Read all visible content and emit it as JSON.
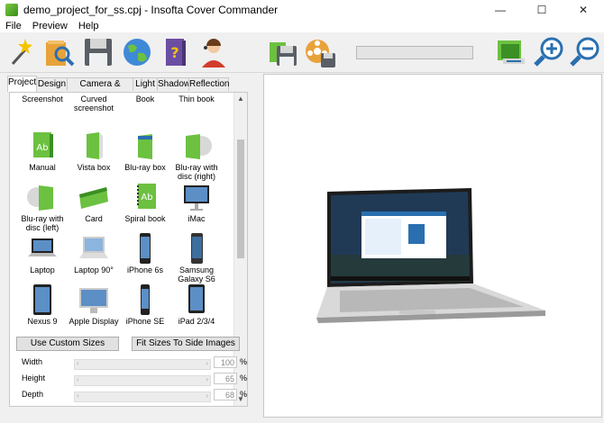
{
  "window": {
    "title": "demo_project_for_ss.cpj - Insofta Cover Commander",
    "minimize": "—",
    "maximize": "☐",
    "close": "✕"
  },
  "menu": [
    "File",
    "Preview",
    "Help"
  ],
  "tabs": [
    "Project",
    "Design",
    "Camera & Position",
    "Light",
    "Shadow",
    "Reflection"
  ],
  "gallery": {
    "items": [
      {
        "label": "Screenshot",
        "icon": "screenshot-icon"
      },
      {
        "label": "Curved screenshot",
        "icon": "curved-screenshot-icon"
      },
      {
        "label": "Book",
        "icon": "book-icon"
      },
      {
        "label": "Thin book",
        "icon": "thin-book-icon"
      },
      {
        "label": "Manual",
        "icon": "manual-icon"
      },
      {
        "label": "Vista box",
        "icon": "vista-box-icon"
      },
      {
        "label": "Blu-ray box",
        "icon": "blu-ray-box-icon"
      },
      {
        "label": "Blu-ray with disc (right)",
        "icon": "blu-ray-disc-right-icon"
      },
      {
        "label": "Blu-ray with disc (left)",
        "icon": "blu-ray-disc-left-icon"
      },
      {
        "label": "Card",
        "icon": "card-icon"
      },
      {
        "label": "Spiral book",
        "icon": "spiral-book-icon"
      },
      {
        "label": "iMac",
        "icon": "imac-icon"
      },
      {
        "label": "Laptop",
        "icon": "laptop-icon"
      },
      {
        "label": "Laptop 90°",
        "icon": "laptop-90-icon"
      },
      {
        "label": "iPhone 6s",
        "icon": "iphone-6s-icon"
      },
      {
        "label": "Samsung Galaxy S6",
        "icon": "samsung-galaxy-s6-icon"
      },
      {
        "label": "Nexus 9",
        "icon": "nexus-9-icon"
      },
      {
        "label": "Apple Display",
        "icon": "apple-display-icon"
      },
      {
        "label": "iPhone SE",
        "icon": "iphone-se-icon"
      },
      {
        "label": "iPad 2/3/4",
        "icon": "ipad-icon"
      }
    ]
  },
  "buttons": {
    "use_custom_sizes": "Use Custom Sizes",
    "fit_sizes": "Fit Sizes To Side Images"
  },
  "sizes": [
    {
      "label": "Width",
      "value": "100",
      "unit": "%"
    },
    {
      "label": "Height",
      "value": "65",
      "unit": "%"
    },
    {
      "label": "Depth",
      "value": "68",
      "unit": "%"
    }
  ],
  "toolbar_icons": [
    "magic-wand-icon",
    "open-folder-icon",
    "save-icon",
    "globe-icon",
    "help-book-icon",
    "support-agent-icon",
    "save-image-icon",
    "save-video-icon",
    "zoom-fit-icon",
    "zoom-in-icon",
    "zoom-out-icon"
  ],
  "colors": {
    "accent": "#0078d7",
    "green": "#6cc140"
  }
}
